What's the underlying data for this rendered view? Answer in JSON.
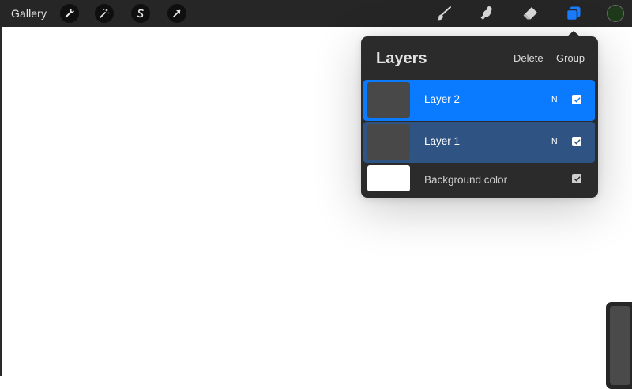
{
  "toolbar": {
    "gallery_label": "Gallery",
    "left_buttons": [
      {
        "icon": "wrench-icon"
      },
      {
        "icon": "magic-wand-icon"
      },
      {
        "icon": "selection-s-icon"
      },
      {
        "icon": "transform-arrow-icon"
      }
    ],
    "tools": [
      {
        "icon": "brush-icon"
      },
      {
        "icon": "smudge-icon"
      },
      {
        "icon": "eraser-icon"
      },
      {
        "icon": "layers-icon",
        "active_color": "#1a7cff"
      }
    ],
    "current_color": "#1f3a1b"
  },
  "layers_panel": {
    "title": "Layers",
    "delete_label": "Delete",
    "group_label": "Group",
    "layers": [
      {
        "name": "Layer 2",
        "blend_mode": "N",
        "visible": true,
        "state": "active"
      },
      {
        "name": "Layer 1",
        "blend_mode": "N",
        "visible": true,
        "state": "selected"
      }
    ],
    "background": {
      "name": "Background color",
      "color": "#ffffff",
      "visible": true
    }
  },
  "colors": {
    "accent_active": "#0a7aff",
    "accent_selected": "#2f5483",
    "panel_bg": "#2b2b2b",
    "toolbar_bg": "#262626"
  }
}
